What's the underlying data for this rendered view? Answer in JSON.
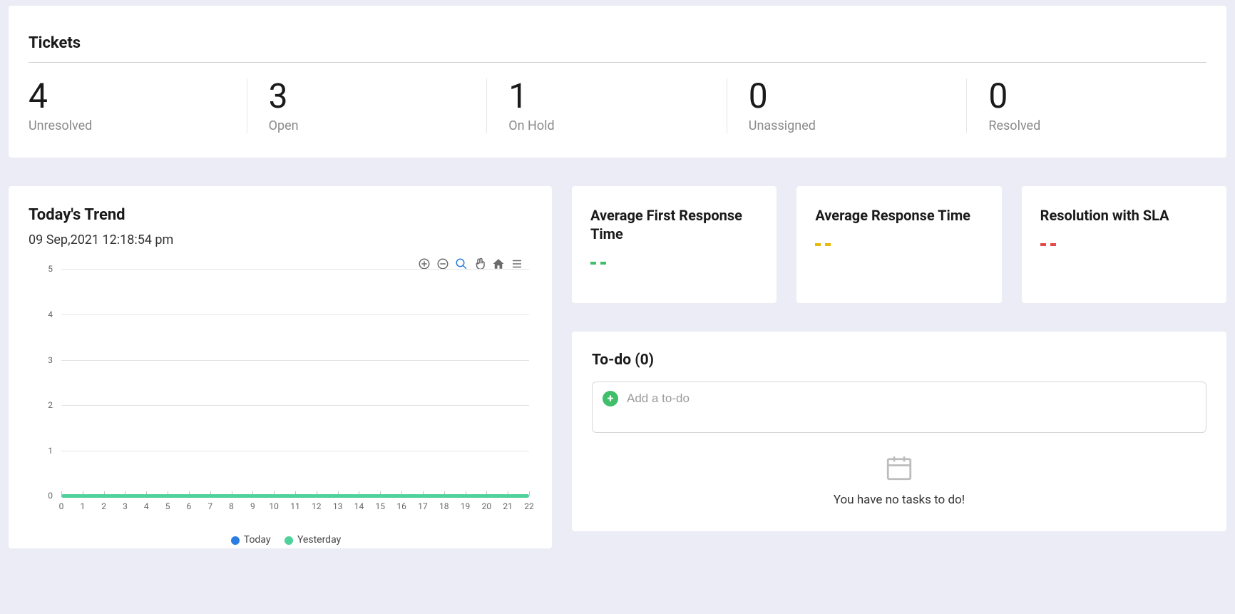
{
  "tickets": {
    "title": "Tickets",
    "stats": [
      {
        "value": "4",
        "label": "Unresolved"
      },
      {
        "value": "3",
        "label": "Open"
      },
      {
        "value": "1",
        "label": "On Hold"
      },
      {
        "value": "0",
        "label": "Unassigned"
      },
      {
        "value": "0",
        "label": "Resolved"
      }
    ]
  },
  "trend": {
    "title": "Today's Trend",
    "timestamp": "09 Sep,2021 12:18:54 pm",
    "legend": {
      "today": "Today",
      "yesterday": "Yesterday"
    }
  },
  "chart_data": {
    "type": "line",
    "xlabel": "",
    "ylabel": "",
    "x": [
      0,
      1,
      2,
      3,
      4,
      5,
      6,
      7,
      8,
      9,
      10,
      11,
      12,
      13,
      14,
      15,
      16,
      17,
      18,
      19,
      20,
      21,
      22
    ],
    "ylim": [
      0,
      5
    ],
    "xlim": [
      0,
      22
    ],
    "y_ticks": [
      0,
      1,
      2,
      3,
      4,
      5
    ],
    "series": [
      {
        "name": "Today",
        "color": "#2a7de1",
        "values": [
          0,
          0,
          0,
          0,
          0,
          0,
          0,
          0,
          0,
          0,
          0,
          0,
          0,
          0,
          0,
          0,
          0,
          0,
          0,
          0,
          0,
          0,
          0
        ]
      },
      {
        "name": "Yesterday",
        "color": "#4ed29a",
        "values": [
          0,
          0,
          0,
          0,
          0,
          0,
          0,
          0,
          0,
          0,
          0,
          0,
          0,
          0,
          0,
          0,
          0,
          0,
          0,
          0,
          0,
          0,
          0
        ]
      }
    ]
  },
  "kpis": [
    {
      "title": "Average First Response Time",
      "color": "green"
    },
    {
      "title": "Average Response Time",
      "color": "yellow"
    },
    {
      "title": "Resolution with SLA",
      "color": "red"
    }
  ],
  "todo": {
    "title": "To-do (0)",
    "placeholder": "Add a to-do",
    "empty_text": "You have no tasks to do!"
  }
}
